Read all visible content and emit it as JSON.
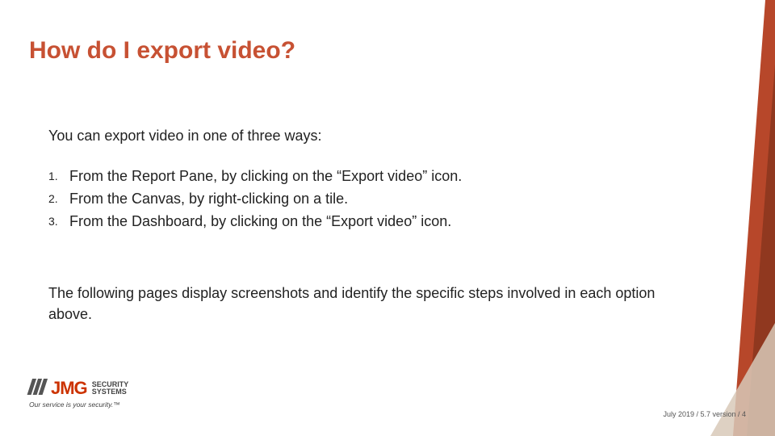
{
  "title": "How do I export video?",
  "intro": "You can export video in one of three ways:",
  "steps": [
    {
      "n": "1.",
      "t": "From the Report Pane, by clicking on the “Export video” icon."
    },
    {
      "n": "2.",
      "t": "From the Canvas, by right-clicking on a tile."
    },
    {
      "n": "3.",
      "t": "From the Dashboard, by clicking on the “Export video” icon."
    }
  ],
  "outro": "The following pages display screenshots and identify the specific steps involved in each option above.",
  "logo": {
    "brand": "JMG",
    "line1": "SECURITY",
    "line2": "SYSTEMS",
    "tagline": "Our service is your security.™"
  },
  "footer": "July 2019 / 5.7 version / 4",
  "colors": {
    "accent": "#c75133"
  }
}
